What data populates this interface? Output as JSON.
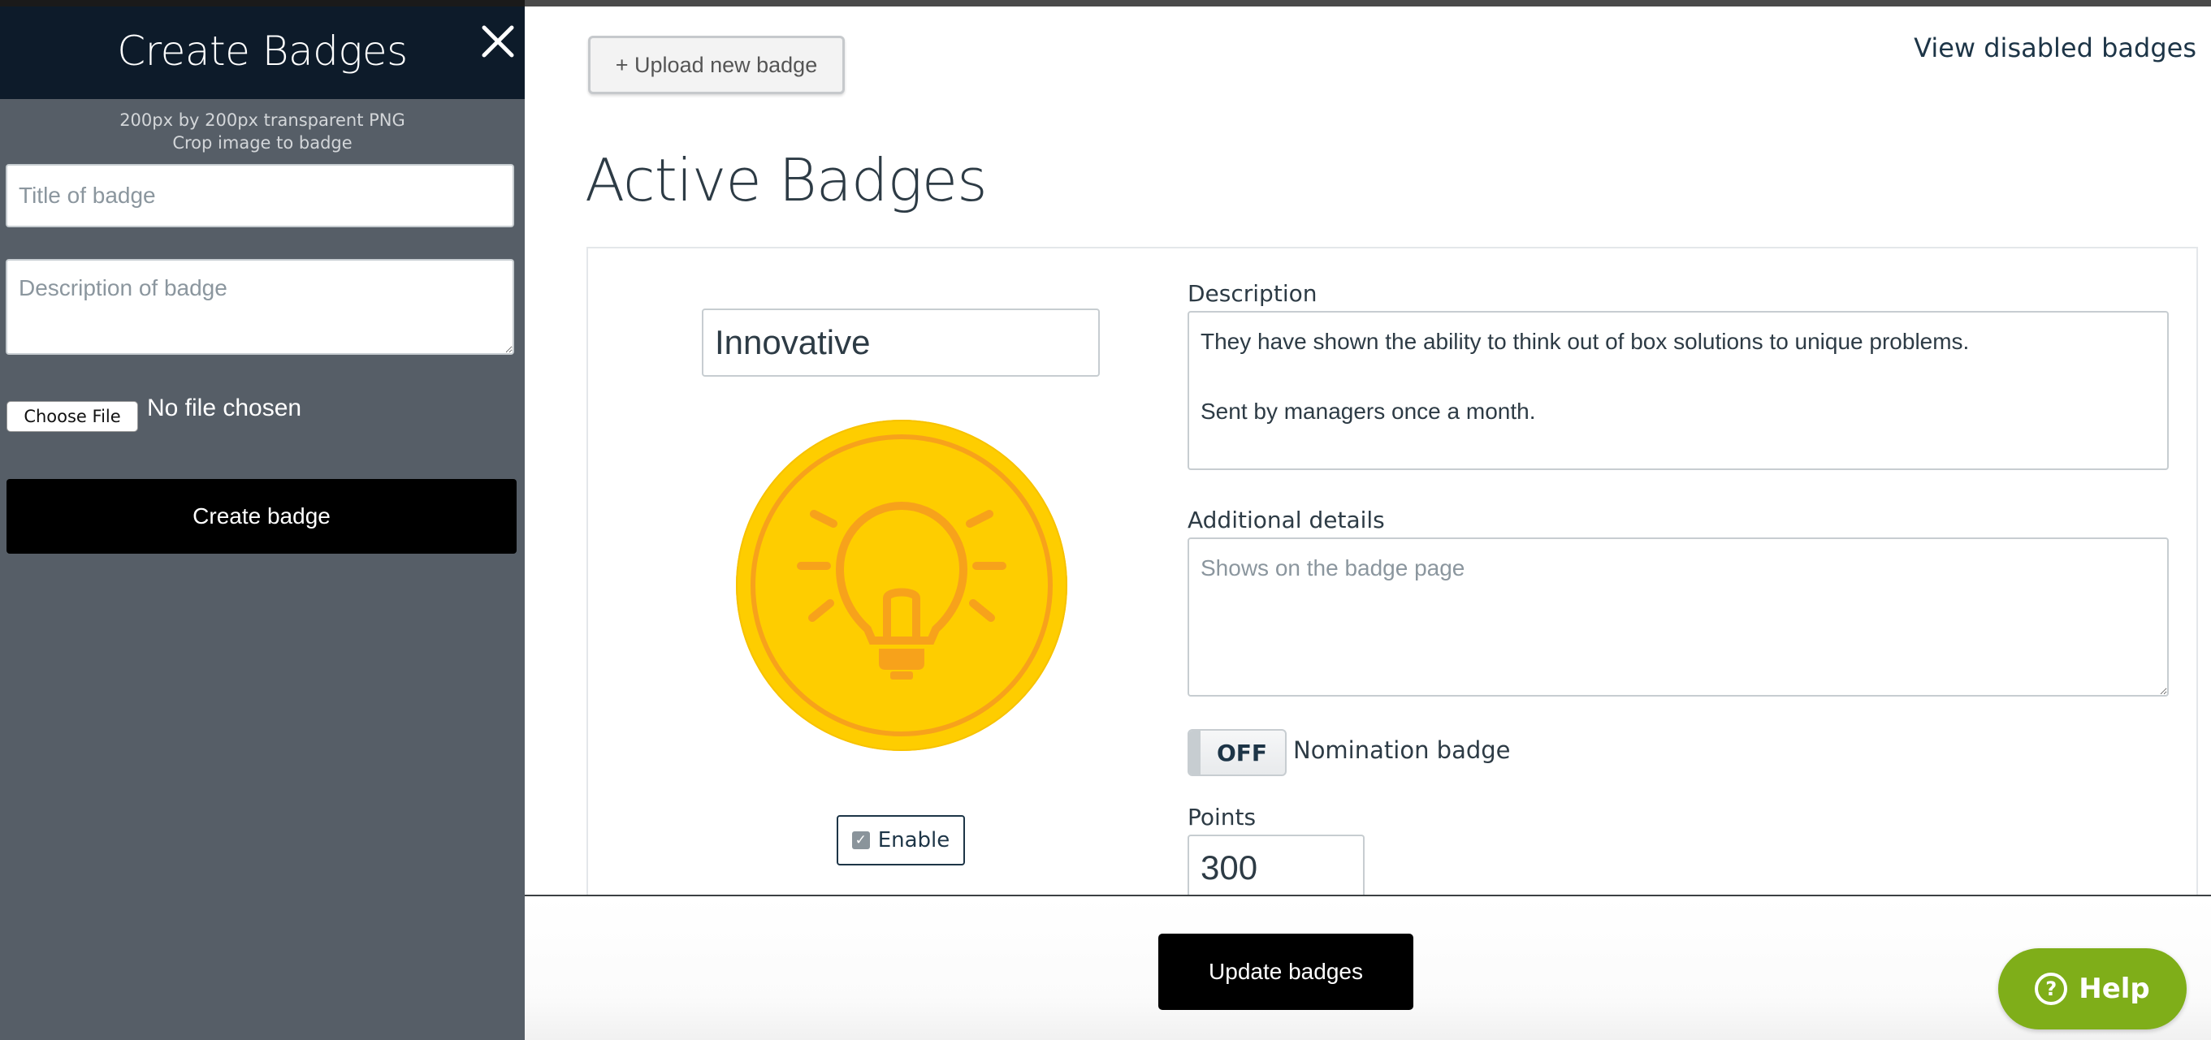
{
  "sidebar": {
    "title": "Create Badges",
    "hint_line1": "200px by 200px transparent PNG",
    "hint_line2": "Crop image to badge",
    "title_placeholder": "Title of badge",
    "description_placeholder": "Description of badge",
    "choose_file_label": "Choose File",
    "no_file_text": "No file chosen",
    "create_button_label": "Create badge",
    "close_icon": "close-icon"
  },
  "toolbar": {
    "upload_label": "+ Upload new badge",
    "disabled_link": "View disabled badges"
  },
  "main": {
    "title": "Active Badges"
  },
  "badge": {
    "name": "Innovative",
    "icon": "lightbulb-icon",
    "enable_label": "Enable",
    "enabled": true,
    "description_label": "Description",
    "description_line1": "They have shown the ability to think out of box solutions to unique problems.",
    "description_line2": "Sent by managers once a month.",
    "additional_label": "Additional details",
    "additional_placeholder": "Shows on the badge page",
    "toggle_state": "OFF",
    "toggle_label": "Nomination badge",
    "points_label": "Points",
    "points": "300"
  },
  "footer": {
    "update_label": "Update badges",
    "help_label": "Help",
    "help_icon": "question-icon"
  },
  "colors": {
    "sidebar_bg": "#565e67",
    "sidebar_header_bg": "#0d1b2a",
    "primary_button": "#000000",
    "help_green": "#7fae19",
    "badge_gold": "#ffc400",
    "badge_orange": "#f7a21b"
  }
}
